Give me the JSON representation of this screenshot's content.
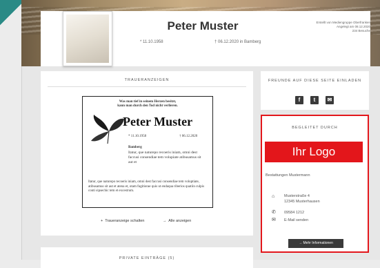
{
  "header": {
    "name": "Peter Muster",
    "born": "* 11.10.1958",
    "died": "† 06.12.2020 in Bamberg",
    "meta_line1": "Erstellt von Mediengruppe Oberfranken",
    "meta_line2": "Angelegt am 08.12.2020",
    "meta_line3": "234 Besuche"
  },
  "notices": {
    "title": "TRAUERANZEIGEN",
    "ad": {
      "intro_line1": "Was man tief in seinem Herzen besitzt,",
      "intro_line2": "kann man durch den Tod nicht verlieren.",
      "name": "Peter Muster",
      "born": "* 11.10.1958",
      "died": "† 06.12.2020",
      "city": "Bamberg",
      "para1": "Itatur, que naturepo recoeris iniam, omni dest faccusi consendiae tem volupiate atibusamus sit aut et",
      "para2": "Itatur, que naturepo recoeris iniam, omni dest faccusi consendiae tem voluptiate, atibusamus sit aut et atena et, otam fugitiorae quis ut endaqua riberios quatiin culpis conti sipsechic tem et excestrum."
    },
    "link_create": "Traueranzeige schalten",
    "link_all": "Alle anzeigen"
  },
  "share": {
    "title": "FREUNDE AUF DIESE SEITE EINLADEN",
    "facebook_icon": "f",
    "twitter_icon": "t",
    "mail_icon": "✉"
  },
  "sponsor": {
    "title": "BEGLEITET DURCH",
    "logo_text": "Ihr Logo",
    "company": "Bestattungen Mustermann",
    "street": "Musterstraße 4",
    "city": "12345 Musterhausen",
    "phone": "09584 1212",
    "email": "E-Mail senden",
    "button": "Mehr Informationen"
  },
  "bottom": {
    "title": "PRIVATE EINTRÄGE (5)"
  },
  "colors": {
    "accent": "#e3161b",
    "button": "#3a3a3a"
  }
}
